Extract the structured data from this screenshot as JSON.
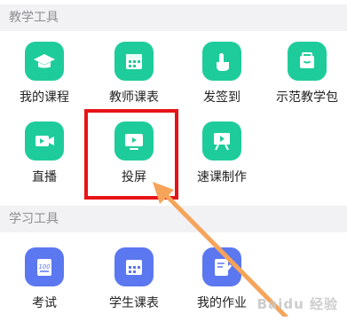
{
  "sections": [
    {
      "title": "教学工具",
      "items": [
        {
          "label": "我的课程",
          "icon": "graduation-cap-icon"
        },
        {
          "label": "教师课表",
          "icon": "calendar-icon"
        },
        {
          "label": "发签到",
          "icon": "hand-tap-icon"
        },
        {
          "label": "示范教学包",
          "icon": "package-icon"
        },
        {
          "label": "直播",
          "icon": "video-camera-icon"
        },
        {
          "label": "投屏",
          "icon": "screen-cast-icon"
        },
        {
          "label": "速课制作",
          "icon": "presentation-board-icon"
        }
      ]
    },
    {
      "title": "学习工具",
      "items": [
        {
          "label": "考试",
          "icon": "exam-paper-icon"
        },
        {
          "label": "学生课表",
          "icon": "calendar-icon"
        },
        {
          "label": "我的作业",
          "icon": "homework-icon"
        }
      ]
    }
  ],
  "annotation": {
    "highlight_color": "#e81316",
    "arrow_color": "#f5a45a"
  },
  "colors": {
    "green": "#1ecc9b",
    "blue": "#5b78f0"
  },
  "watermark": "Baidu 经验"
}
